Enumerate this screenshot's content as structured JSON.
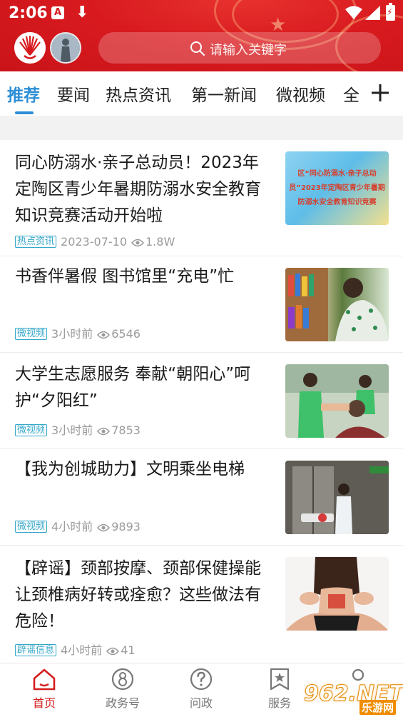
{
  "status_bar": {
    "time": "2:06",
    "icon_a": "A"
  },
  "search": {
    "placeholder": "请输入关键字"
  },
  "tabs": [
    {
      "label": "推荐",
      "active": true
    },
    {
      "label": "要闻"
    },
    {
      "label": "热点资讯"
    },
    {
      "label": "第一新闻"
    },
    {
      "label": "微视频"
    },
    {
      "label": "全"
    }
  ],
  "news": [
    {
      "title": "同心防溺水·亲子总动员！2023年定陶区青少年暑期防溺水安全教育知识竞赛活动开始啦",
      "tag": "热点资讯",
      "time": "2023-07-10",
      "views": "1.8W",
      "thumb_text": "区“同心防溺水·亲子总动员”2023年定陶区青少年暑期防溺水安全教育知识竞赛"
    },
    {
      "title": "书香伴暑假  图书馆里“充电”忙",
      "tag": "微视频",
      "time": "3小时前",
      "views": "6546"
    },
    {
      "title": "大学生志愿服务  奉献“朝阳心”呵护“夕阳红”",
      "tag": "微视频",
      "time": "3小时前",
      "views": "7853"
    },
    {
      "title": "【我为创城助力】文明乘坐电梯",
      "tag": "微视频",
      "time": "4小时前",
      "views": "9893"
    },
    {
      "title": "【辟谣】颈部按摩、颈部保健操能让颈椎病好转或痊愈？这些做法有危险！",
      "tag": "辟谣信息",
      "time": "4小时前",
      "views": "41"
    }
  ],
  "bottom_nav": [
    {
      "label": "首页",
      "icon": "home-icon",
      "active": true
    },
    {
      "label": "政务号",
      "icon": "gov-account-icon"
    },
    {
      "label": "问政",
      "icon": "question-icon"
    },
    {
      "label": "服务",
      "icon": "service-icon"
    }
  ],
  "watermark": {
    "text": "962.NET",
    "sub": "乐游网"
  },
  "colors": {
    "header_red": "#d81a1f",
    "accent_blue": "#2e8fd6",
    "tag_blue": "#34a7c9",
    "nav_active_red": "#d61e1e"
  }
}
